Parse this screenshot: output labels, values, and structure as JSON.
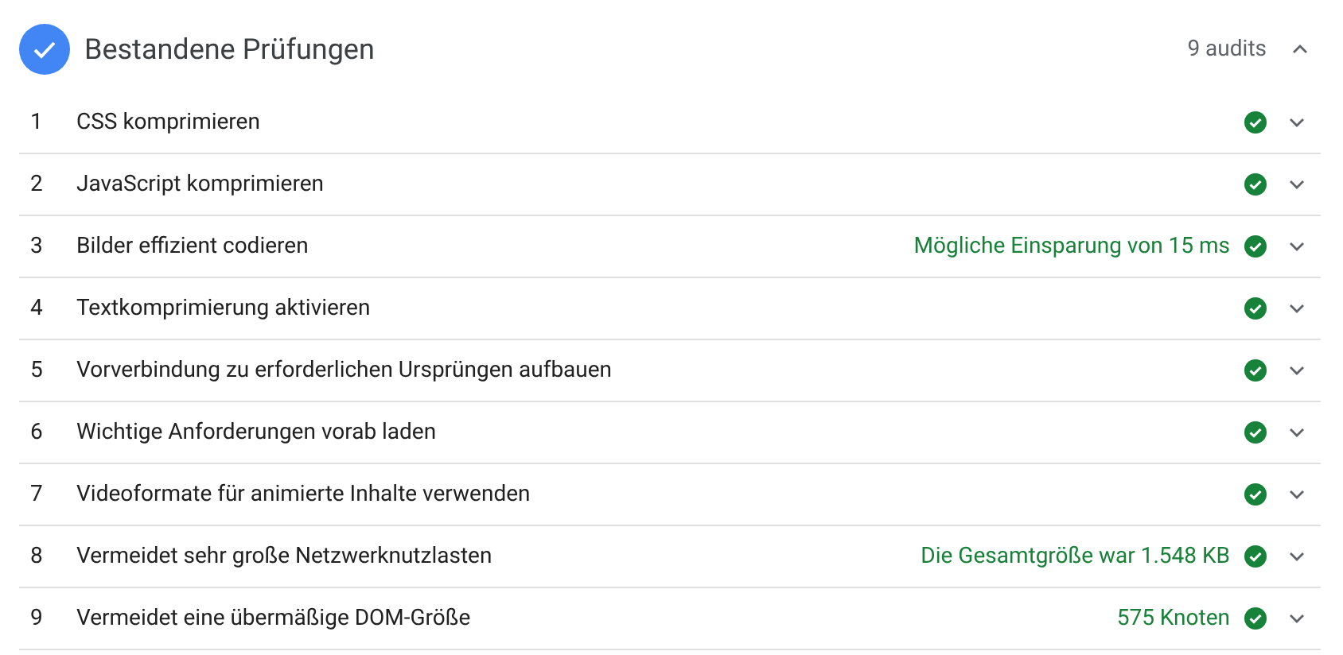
{
  "group": {
    "title": "Bestandene Prüfungen",
    "count": "9 audits",
    "expanded": true
  },
  "audits": [
    {
      "number": "1",
      "title": "CSS komprimieren",
      "expanded": false
    },
    {
      "number": "2",
      "title": "JavaScript komprimieren",
      "expanded": false
    },
    {
      "number": "3",
      "title": "Bilder effizient codieren",
      "summary": "Mögliche Einsparung von 15 ms",
      "expanded": false
    },
    {
      "number": "4",
      "title": "Textkomprimierung aktivieren",
      "expanded": false
    },
    {
      "number": "5",
      "title": "Vorverbindung zu erforderlichen Ursprüngen aufbauen",
      "expanded": false
    },
    {
      "number": "6",
      "title": "Wichtige Anforderungen vorab laden",
      "expanded": false
    },
    {
      "number": "7",
      "title": "Videoformate für animierte Inhalte verwenden",
      "expanded": false
    },
    {
      "number": "8",
      "title": "Vermeidet sehr große Netzwerknutzlasten",
      "summary": "Die Gesamtgröße war 1.548 KB",
      "expanded": false
    },
    {
      "number": "9",
      "title": "Vermeidet eine übermäßige DOM-Größe",
      "summary": "575 Knoten",
      "expanded": false
    }
  ]
}
